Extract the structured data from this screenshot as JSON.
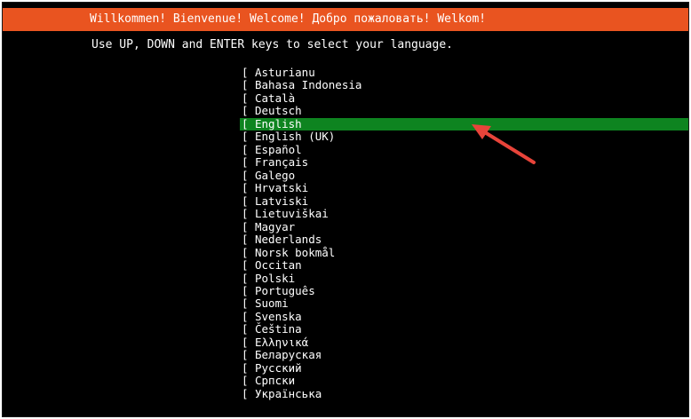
{
  "header": {
    "title": "Willkommen! Bienvenue! Welcome! Добро пожаловать! Welkom!"
  },
  "instruction": "Use UP, DOWN and ENTER keys to select your language.",
  "colors": {
    "header_bg": "#e95420",
    "selected_bg": "#0e8420",
    "arrow": "#e8443a"
  },
  "languages": {
    "bracket": "[",
    "selected_index": 4,
    "items": [
      "Asturianu",
      "Bahasa Indonesia",
      "Català",
      "Deutsch",
      "English",
      "English (UK)",
      "Español",
      "Français",
      "Galego",
      "Hrvatski",
      "Latviski",
      "Lietuviškai",
      "Magyar",
      "Nederlands",
      "Norsk bokmål",
      "Occitan",
      "Polski",
      "Português",
      "Suomi",
      "Svenska",
      "Čeština",
      "Ελληνικά",
      "Беларуская",
      "Русский",
      "Српски",
      "Українська"
    ]
  },
  "annotation": {
    "icon": "arrow-icon"
  }
}
